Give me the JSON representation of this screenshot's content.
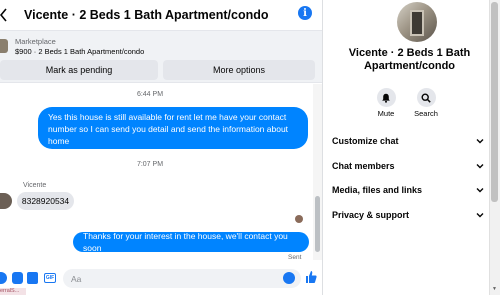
{
  "header": {
    "title": "Vicente · 2 Beds 1 Bath Apartment/condo",
    "info_glyph": "i"
  },
  "marketplace": {
    "label": "Marketplace",
    "listing": "$900 · 2 Beds 1 Bath Apartment/condo",
    "mark_pending": "Mark as pending",
    "more_options": "More options"
  },
  "conversation": {
    "timestamp_1": "6:44 PM",
    "outgoing_1": "Yes this house is still available for rent let me have your contact number so I can send you detail and send the information about home",
    "timestamp_2": "7:07 PM",
    "sender_name": "Vicente",
    "incoming_1": "8328920534",
    "outgoing_2": "Thanks for your interest in the house, we'll contact you soon",
    "sent_status": "Sent"
  },
  "composer": {
    "placeholder": "Aa",
    "gif_label": "GIF"
  },
  "taskbar_fragment": "erralS...",
  "sidebar": {
    "title": "Vicente · 2 Beds 1 Bath Apartment/condo",
    "actions": [
      {
        "label": "Mute",
        "icon": "bell-icon"
      },
      {
        "label": "Search",
        "icon": "search-icon"
      }
    ],
    "rows": [
      {
        "label": "Customize chat"
      },
      {
        "label": "Chat members"
      },
      {
        "label": "Media, files and links"
      },
      {
        "label": "Privacy & support"
      }
    ]
  },
  "colors": {
    "accent": "#0084ff",
    "brand": "#1877f2",
    "incoming_bubble": "#e4e6eb",
    "panel_bg": "#f0f2f5",
    "secondary_text": "#65676b"
  }
}
